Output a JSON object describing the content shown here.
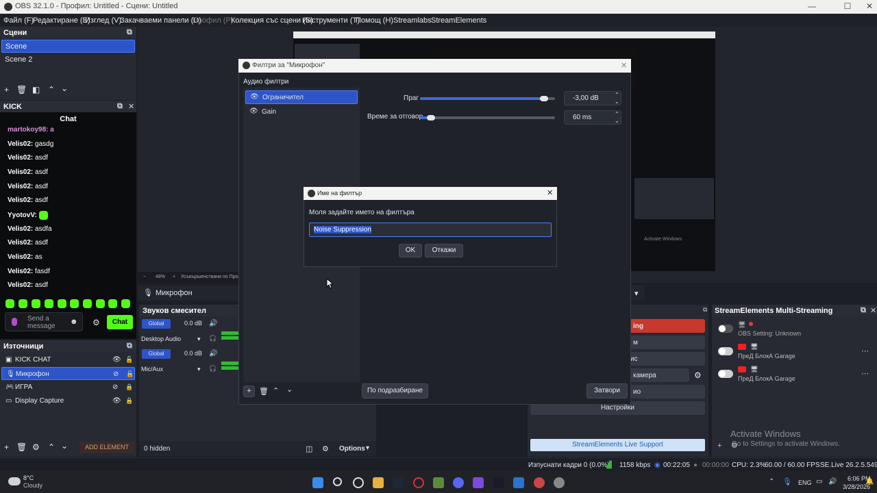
{
  "window": {
    "title": "OBS 32.1.0 - Профил: Untitled - Сцени: Untitled",
    "minimize": "—",
    "maximize": "☐",
    "close": "✕"
  },
  "menu": [
    "Файл (F)",
    "Редактиране (E)",
    "Изглед (V)",
    "Закачваеми панели (D)",
    "Профил (P)",
    "Колекция със сцени (S)",
    "Инструменти (T)",
    "Помощ (H)",
    "Streamlabs",
    "StreamElements"
  ],
  "scenes": {
    "title": "Сцени",
    "items": [
      "Scene",
      "Scene 2"
    ]
  },
  "kick": {
    "title": "KICK",
    "chat_title": "Chat",
    "partial_line": "martokoy98: a",
    "messages": [
      {
        "user": "Velis02:",
        "text": "gasdg"
      },
      {
        "user": "Velis02:",
        "text": "asdf"
      },
      {
        "user": "Velis02:",
        "text": "asdf"
      },
      {
        "user": "Velis02:",
        "text": "asdf"
      },
      {
        "user": "Velis02:",
        "text": "asdf"
      },
      {
        "user": "YyotovV:",
        "text": ""
      },
      {
        "user": "Velis02:",
        "text": "asdfa"
      },
      {
        "user": "Velis02:",
        "text": "asdf"
      },
      {
        "user": "Velis02:",
        "text": "as"
      },
      {
        "user": "Velis02:",
        "text": "fasdf"
      },
      {
        "user": "Velis02:",
        "text": "asdf"
      }
    ],
    "input_placeholder": "Send a message",
    "send_label": "Chat"
  },
  "sources": {
    "title": "Източници",
    "items": [
      "KICK CHAT",
      "Микрофон",
      "ИГРА",
      "Display Capture"
    ],
    "add_element": "ADD ELEMENT"
  },
  "preview": {
    "zoom": "48%",
    "zoom_label": "Усъвършенствани по Прозорец",
    "mic_label": "Микрофон"
  },
  "mixer": {
    "title": "Звуков смесител",
    "channels": [
      {
        "badge": "Global",
        "db": "0.0 dB",
        "name": "Desktop Audio"
      },
      {
        "badge": "Global",
        "db": "0.0 dB",
        "name": "Mic/Aux"
      }
    ],
    "hidden": "0 hidden",
    "options": "Options"
  },
  "filters_dialog": {
    "title": "Филтри за \"Микрофон\"",
    "section": "Аудио филтри",
    "filters": [
      "Ограничител",
      "Gain"
    ],
    "threshold_label": "Праг",
    "threshold_value": "-3,00 dB",
    "threshold_level": 0.92,
    "release_label": "Време за отговор",
    "release_value": "60 ms",
    "release_level": 0.05,
    "defaults_button": "По подразбиране",
    "close_button": "Затвори"
  },
  "name_dialog": {
    "title": "Име на филтър",
    "prompt": "Моля задайте името на филтъра",
    "value": "Noise Suppression",
    "ok": "OK",
    "cancel": "Откажи"
  },
  "controls": {
    "items": [
      "ing",
      "м",
      "ис",
      "камера",
      "ио",
      "Настройки"
    ],
    "support": "StreamElements Live Support"
  },
  "multistream": {
    "title": "StreamElements Multi-Streaming",
    "rows": [
      "OBS Setting: Unknown",
      "ПреД БлокА Garage",
      "ПреД БлокА Garage"
    ]
  },
  "activate": {
    "title": "Activate Windows",
    "sub": "Go to Settings to activate Windows."
  },
  "status_bar": {
    "dropped": "Изпуснати кадри 0 (0.0%)",
    "kbps": "1158 kbps",
    "time1": "00:22:05",
    "time2": "00:00:00",
    "cpu": "CPU: 2.3%",
    "fps": "60.00 / 60.00 FPS",
    "version": "SE.Live 26.2.5.549"
  },
  "taskbar": {
    "weather_temp": "8°C",
    "weather_desc": "Cloudy",
    "lang": "ENG",
    "time": "6:06 PM",
    "date": "3/28/2026"
  }
}
